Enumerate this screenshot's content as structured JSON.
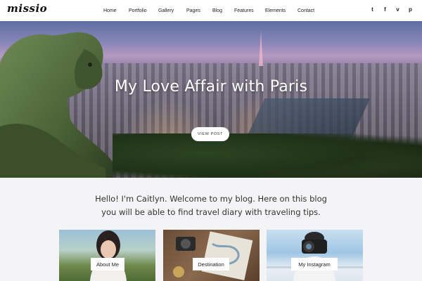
{
  "header": {
    "logo": "missio",
    "nav": [
      "Home",
      "Portfolio",
      "Gallery",
      "Pages",
      "Blog",
      "Features",
      "Elements",
      "Contact"
    ],
    "social": [
      {
        "icon": "twitter-icon",
        "glyph": "t"
      },
      {
        "icon": "facebook-icon",
        "glyph": "f"
      },
      {
        "icon": "vimeo-icon",
        "glyph": "v"
      },
      {
        "icon": "pinterest-icon",
        "glyph": "p"
      }
    ]
  },
  "hero": {
    "title": "My Love Affair with Paris",
    "button": "VIEW POST"
  },
  "intro": {
    "line1": "Hello! I'm Caitlyn. Welcome to my blog. Here on this blog",
    "line2": "you will be able to find travel diary with traveling tips."
  },
  "cards": [
    {
      "label": "About Me"
    },
    {
      "label": "Destination"
    },
    {
      "label": "My Instagram"
    }
  ],
  "colors": {
    "header_bg": "#ffffff",
    "page_bg": "#f4f4f6",
    "text": "#333333"
  }
}
